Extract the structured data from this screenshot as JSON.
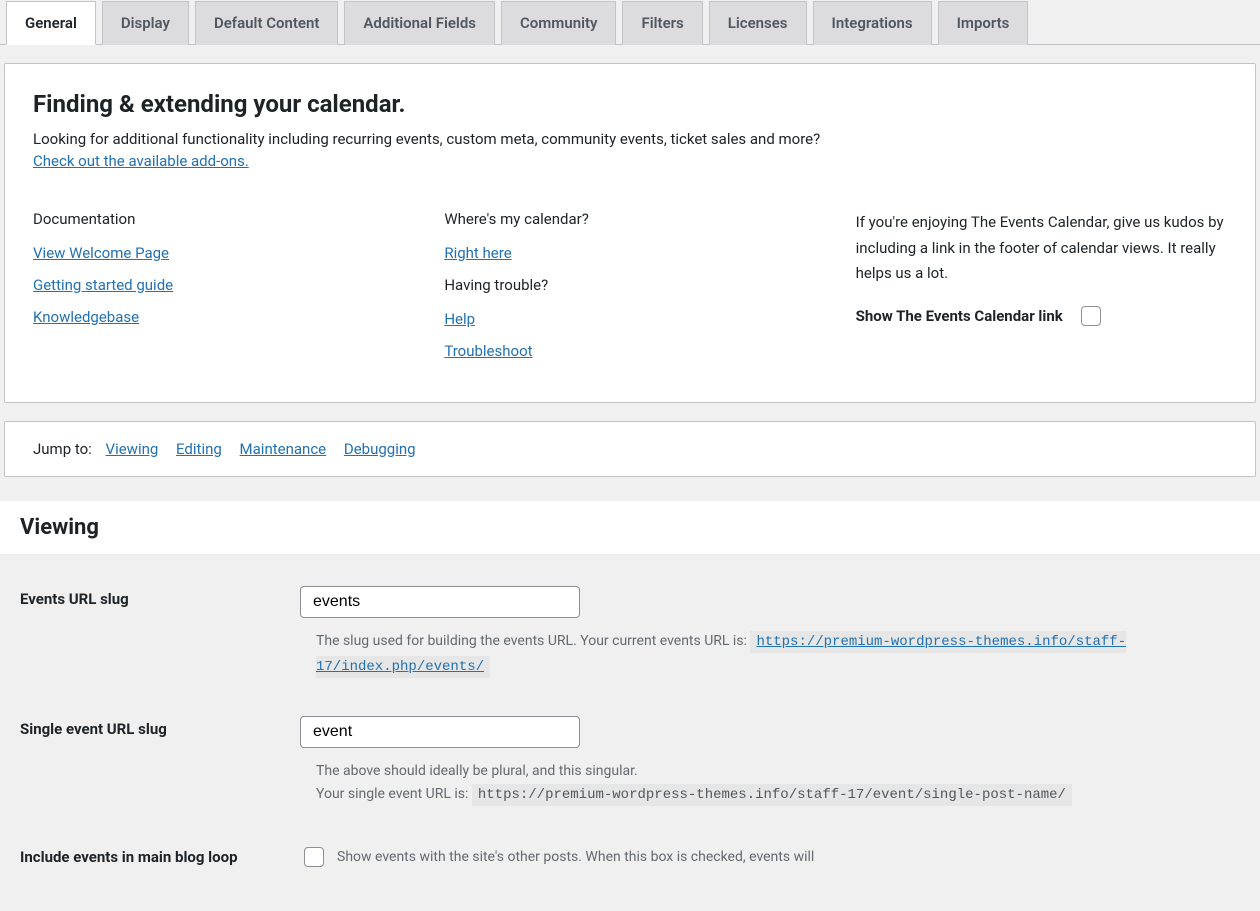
{
  "tabs": [
    {
      "label": "General",
      "active": true
    },
    {
      "label": "Display"
    },
    {
      "label": "Default Content"
    },
    {
      "label": "Additional Fields"
    },
    {
      "label": "Community"
    },
    {
      "label": "Filters"
    },
    {
      "label": "Licenses"
    },
    {
      "label": "Integrations"
    },
    {
      "label": "Imports"
    }
  ],
  "intro": {
    "heading": "Finding & extending your calendar.",
    "lead": "Looking for additional functionality including recurring events, custom meta, community events, ticket sales and more?",
    "addons_link": "Check out the available add-ons."
  },
  "columns": {
    "docs": {
      "heading": "Documentation",
      "links": {
        "welcome": "View Welcome Page",
        "guide": "Getting started guide",
        "kb": "Knowledgebase"
      }
    },
    "help": {
      "where_heading": "Where's my calendar?",
      "right_here": "Right here",
      "trouble_heading": "Having trouble?",
      "help": "Help",
      "troubleshoot": "Troubleshoot"
    },
    "kudos": {
      "text": "If you're enjoying The Events Calendar, give us kudos by including a link in the footer of calendar views. It really helps us a lot.",
      "checkbox_label": "Show The Events Calendar link"
    }
  },
  "jump": {
    "label": "Jump to:",
    "links": {
      "viewing": "Viewing",
      "editing": "Editing",
      "maintenance": "Maintenance",
      "debugging": "Debugging"
    }
  },
  "viewing_section": {
    "heading": "Viewing",
    "events_slug": {
      "label": "Events URL slug",
      "value": "events",
      "desc_prefix": "The slug used for building the events URL. Your current events URL is: ",
      "url": "https://premium-wordpress-themes.info/staff-17/index.php/events/"
    },
    "single_slug": {
      "label": "Single event URL slug",
      "value": "event",
      "desc_line1": "The above should ideally be plural, and this singular.",
      "desc_line2_prefix": "Your single event URL is: ",
      "url": "https://premium-wordpress-themes.info/staff-17/event/single-post-name/"
    },
    "main_loop": {
      "label": "Include events in main blog loop",
      "desc": "Show events with the site's other posts. When this box is checked, events will"
    }
  }
}
